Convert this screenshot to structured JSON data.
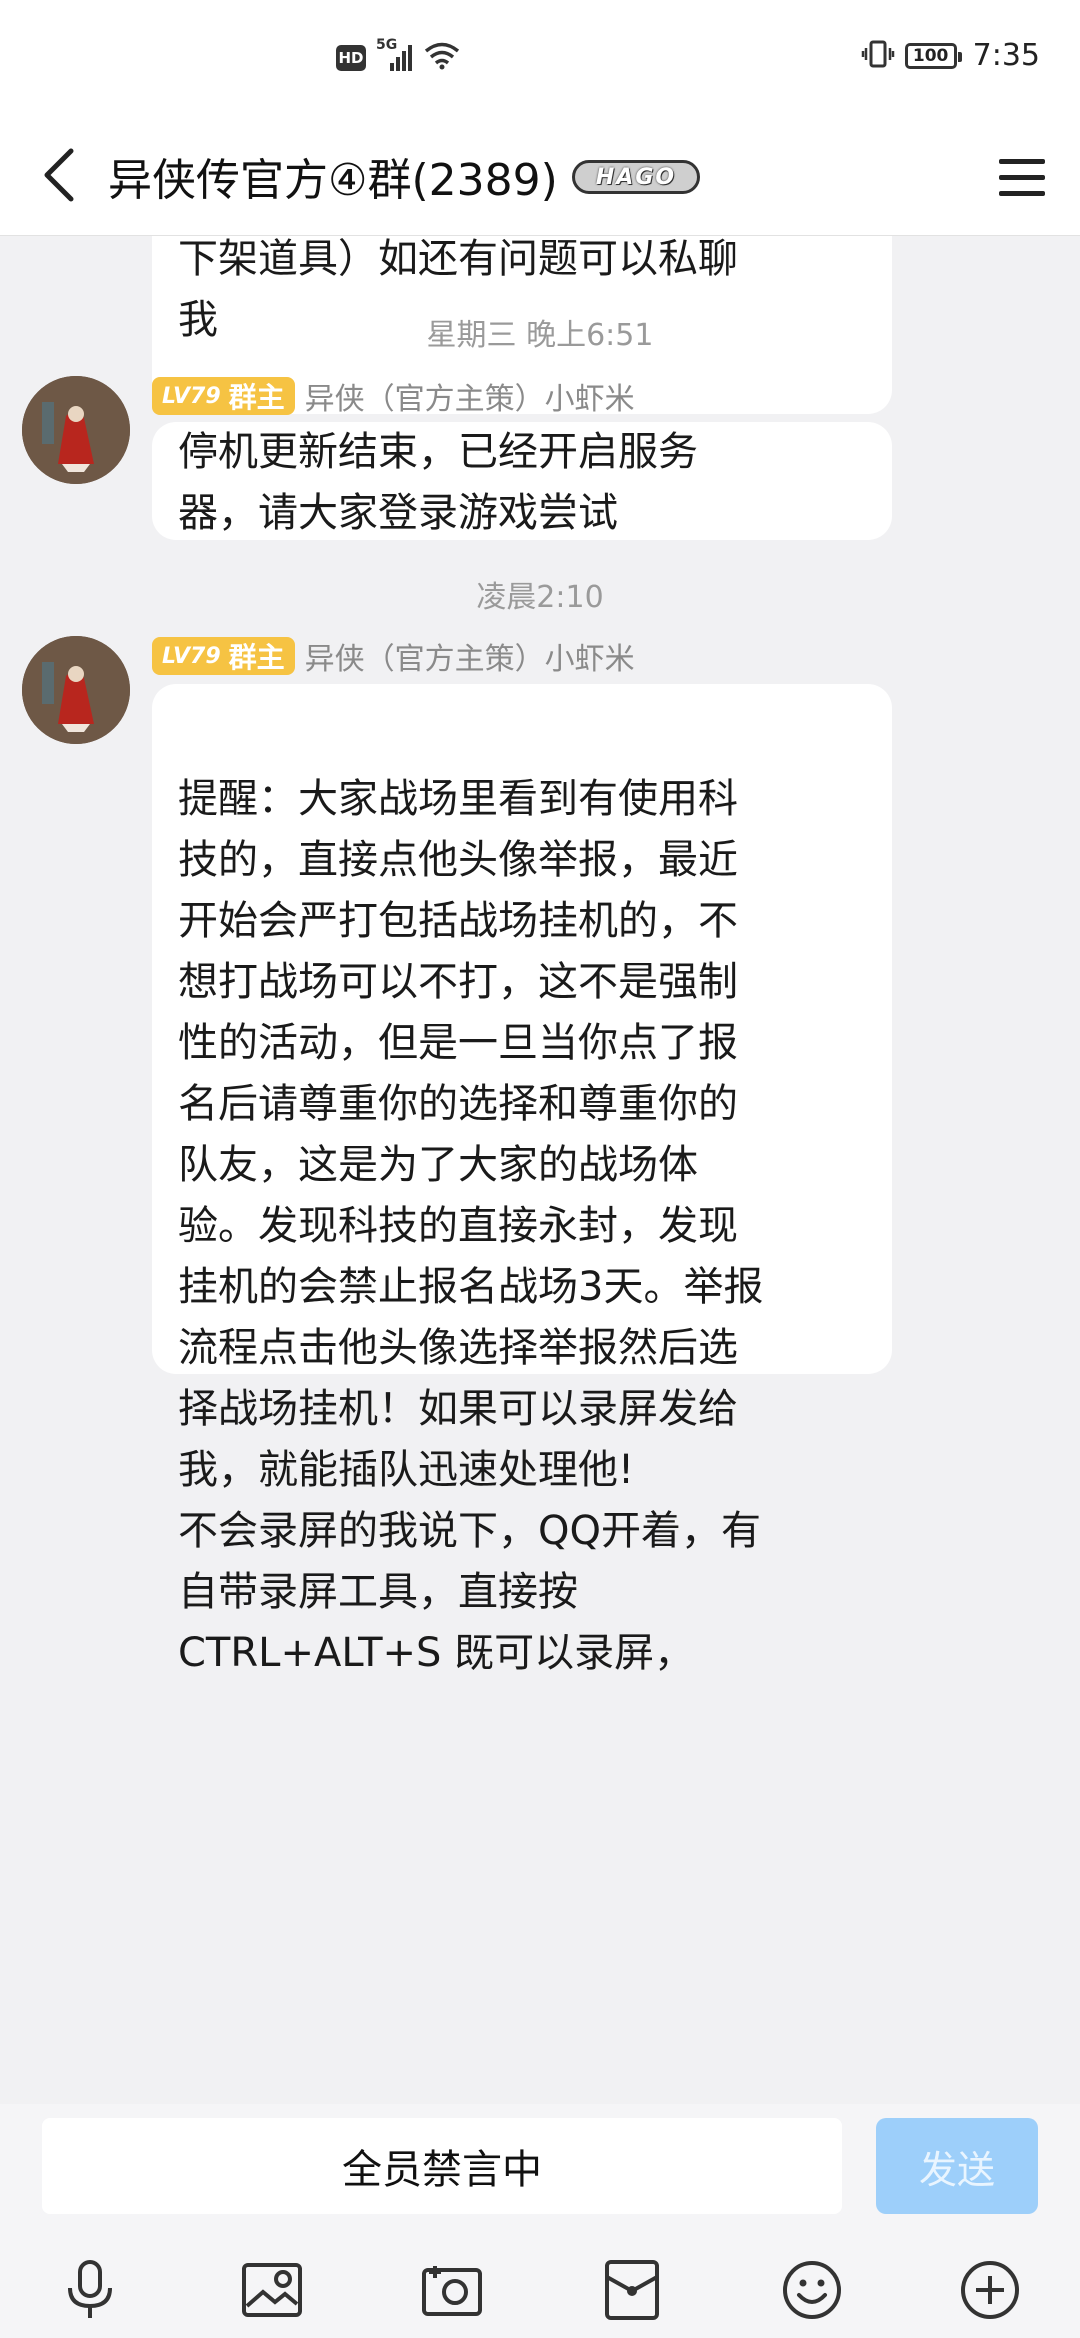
{
  "status_bar": {
    "hd": "HD",
    "network": "5G",
    "battery": "100",
    "time": "7:35"
  },
  "header": {
    "title": "异侠传官方④群(2389)",
    "badge": "HAGO"
  },
  "messages": {
    "top_partial": "可取回！（暂不支持上架，只能\n下架道具）如还有问题可以私聊\n我",
    "ts1": "星期三 晚上6:51",
    "m1": {
      "level": "LV79",
      "role": "群主",
      "sender": "异侠（官方主策）小虾米",
      "text": "停机更新结束，已经开启服务\n器，请大家登录游戏尝试"
    },
    "ts2": "凌晨2:10",
    "m2": {
      "level": "LV79",
      "role": "群主",
      "sender": "异侠（官方主策）小虾米",
      "text": "\n提醒：大家战场里看到有使用科\n技的，直接点他头像举报，最近\n开始会严打包括战场挂机的，不\n想打战场可以不打，这不是强制\n性的活动，但是一旦当你点了报\n名后请尊重你的选择和尊重你的\n队友，这是为了大家的战场体\n验。发现科技的直接永封，发现\n挂机的会禁止报名战场3天。举报\n流程点击他头像选择举报然后选\n择战场挂机！如果可以录屏发给\n我，就能插队迅速处理他!\n不会录屏的我说下，QQ开着，有\n自带录屏工具，直接按\nCTRL+ALT+S 既可以录屏，"
    }
  },
  "input": {
    "muted_text": "全员禁言中",
    "send_label": "发送"
  },
  "toolbar_icons": [
    "microphone-icon",
    "image-icon",
    "camera-icon",
    "red-packet-icon",
    "emoji-icon",
    "plus-icon"
  ]
}
